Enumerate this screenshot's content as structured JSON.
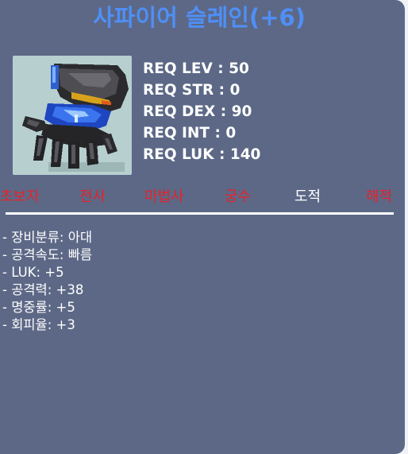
{
  "item": {
    "name": "사파이어 슬레인(+6)",
    "icon": "glove-icon",
    "colors": {
      "title": "#4f8ff6",
      "panel": "#5c6886",
      "job_available": "#e8212a",
      "job_current": "#ffffff"
    }
  },
  "requirements": [
    {
      "label": "REQ LEV : 50"
    },
    {
      "label": "REQ STR : 0"
    },
    {
      "label": "REQ DEX : 90"
    },
    {
      "label": "REQ INT : 0"
    },
    {
      "label": "REQ LUK : 140"
    }
  ],
  "jobs": [
    {
      "label": "초보자",
      "active": false
    },
    {
      "label": "전사",
      "active": false
    },
    {
      "label": "마법사",
      "active": false
    },
    {
      "label": "궁수",
      "active": false
    },
    {
      "label": "도적",
      "active": true
    },
    {
      "label": "해적",
      "active": false
    }
  ],
  "stats": [
    {
      "text": "- 장비분류: 아대"
    },
    {
      "text": "- 공격속도: 빠름"
    },
    {
      "text": "- LUK: +5"
    },
    {
      "text": "- 공격력: +38"
    },
    {
      "text": "- 명중률: +5"
    },
    {
      "text": "- 회피율: +3"
    }
  ]
}
